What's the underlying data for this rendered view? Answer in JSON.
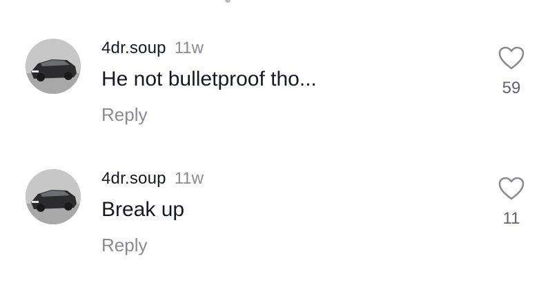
{
  "comments": [
    {
      "username": "4dr.soup",
      "time_ago": "11w",
      "text": "He not bulletproof tho...",
      "reply_label": "Reply",
      "likes": "59"
    },
    {
      "username": "4dr.soup",
      "time_ago": "11w",
      "text": "Break up",
      "reply_label": "Reply",
      "likes": "11"
    }
  ],
  "icons": {
    "like": "heart-outline-icon",
    "avatar": "car-avatar"
  },
  "colors": {
    "primary_text": "#161823",
    "secondary_text": "#8a8b91",
    "like_icon": "#8a8b91"
  }
}
